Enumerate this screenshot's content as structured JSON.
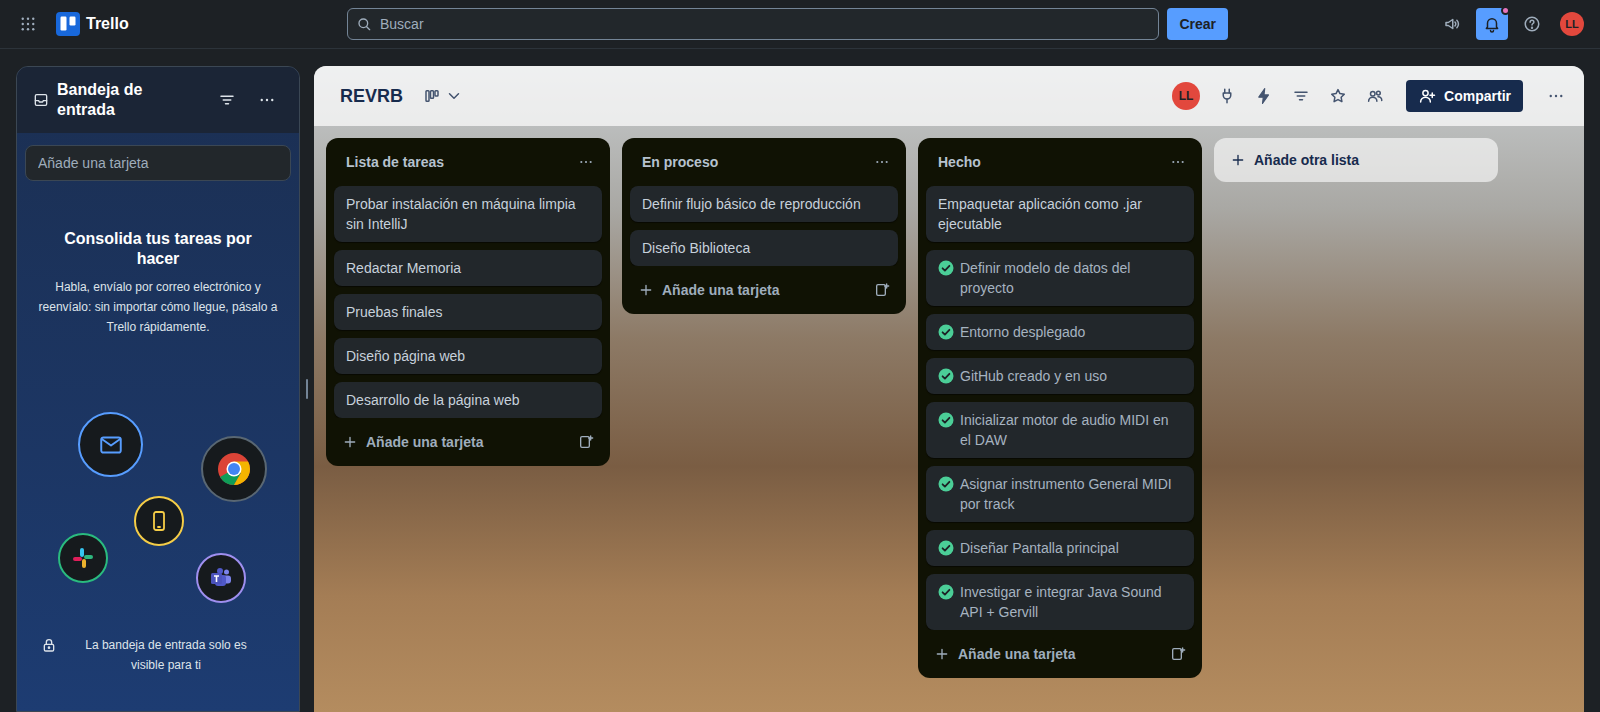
{
  "topbar": {
    "app": "Trello",
    "search": {
      "placeholder": "Buscar"
    },
    "create": "Crear",
    "notifications": {
      "selected": true,
      "unread": true
    },
    "avatar": "LL"
  },
  "inbox": {
    "title": "Bandeja de entrada",
    "input": {
      "placeholder": "Añade una tarjeta"
    },
    "heading": "Consolida tus tareas por hacer",
    "text": "Habla, envíalo por correo electrónico y reenvíalo: sin importar cómo llegue, pásalo a Trello rápidamente.",
    "privacy": "La bandeja de entrada solo es visible para ti"
  },
  "board": {
    "name": "REVRB",
    "member": "LL",
    "share": "Compartir",
    "add_list": "Añade otra lista",
    "lists": [
      {
        "title": "Lista de tareas",
        "add_card": "Añade una tarjeta",
        "cards": [
          {
            "text": "Probar instalación en máquina limpia sin IntelliJ",
            "done": false
          },
          {
            "text": "Redactar Memoria",
            "done": false
          },
          {
            "text": "Pruebas finales",
            "done": false
          },
          {
            "text": "Diseño página web",
            "done": false
          },
          {
            "text": "Desarrollo de la página web",
            "done": false
          }
        ]
      },
      {
        "title": "En proceso",
        "add_card": "Añade una tarjeta",
        "cards": [
          {
            "text": "Definir flujo básico de reproducción",
            "done": false
          },
          {
            "text": "Diseño Biblioteca",
            "done": false
          }
        ]
      },
      {
        "title": "Hecho",
        "add_card": "Añade una tarjeta",
        "cards": [
          {
            "text": "Empaquetar aplicación como .jar ejecutable",
            "done": false
          },
          {
            "text": "Definir modelo de datos del proyecto",
            "done": true
          },
          {
            "text": "Entorno desplegado",
            "done": true
          },
          {
            "text": "GitHub creado y en uso",
            "done": true
          },
          {
            "text": "Inicializar motor de audio MIDI en el DAW",
            "done": true
          },
          {
            "text": "Asignar instrumento General MIDI por track",
            "done": true
          },
          {
            "text": "Diseñar Pantalla principal",
            "done": true
          },
          {
            "text": "Investigar e integrar Java Sound API + Gervill",
            "done": true
          }
        ]
      }
    ]
  }
}
